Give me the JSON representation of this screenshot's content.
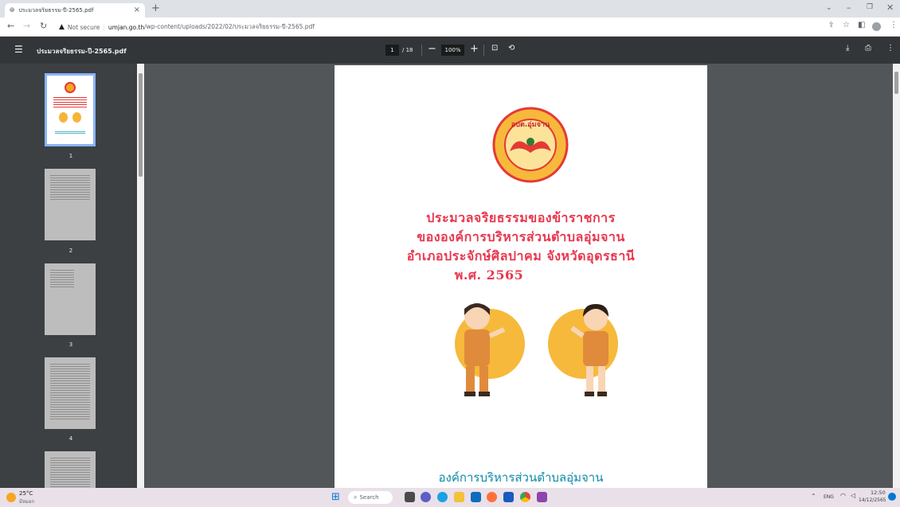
{
  "browser": {
    "tab_title": "ประมวลจริยธรรม-ปี-2565.pdf",
    "new_tab": "+",
    "tab_close": "×",
    "url_security": "Not secure",
    "url_host": "umjan.go.th",
    "url_path": "/wp-content/uploads/2022/02/ประมวลจริยธรรม-ปี-2565.pdf"
  },
  "pdf_toolbar": {
    "file_name": "ประมวลจริยธรรม-ปี-2565.pdf",
    "current_page": "1",
    "total_pages": "/ 18",
    "zoom": "100%"
  },
  "thumbnails": [
    {
      "label": "1"
    },
    {
      "label": "2"
    },
    {
      "label": "3"
    },
    {
      "label": "4"
    }
  ],
  "document": {
    "seal_text": "อบต.อุ่มจาน",
    "title_lines": [
      "ประมวลจริยธรรมของข้าราชการ",
      "ขององค์การบริหารส่วนตำบลอุ่มจาน",
      "อำเภอประจักษ์ศิลปาคม  จังหวัดอุดรธานี",
      "พ.ศ. 2565"
    ],
    "footer_org": "องค์การบริหารส่วนตำบลอุ่มจาน"
  },
  "taskbar": {
    "weather_temp": "25°C",
    "weather_desc": "มีหมอก",
    "search_label": "Search",
    "lang": "ENG",
    "time": "12:50",
    "date": "14/12/2565"
  }
}
